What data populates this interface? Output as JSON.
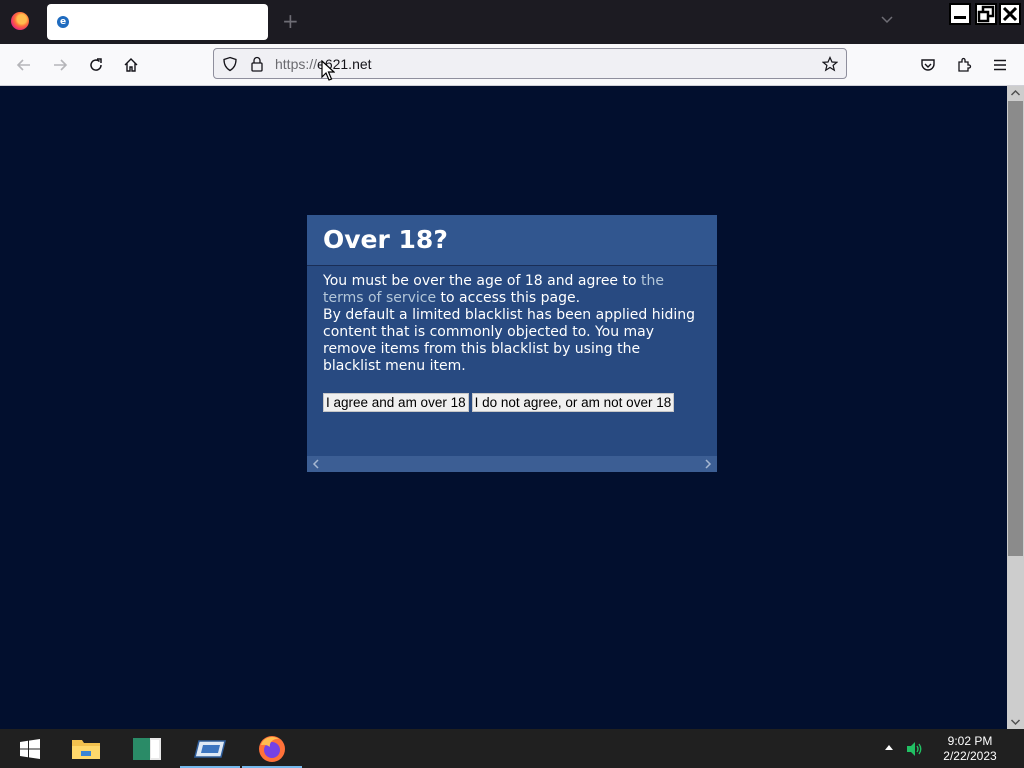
{
  "browser": {
    "tab": {
      "title": ""
    },
    "new_tab_label": "+",
    "url": {
      "scheme": "https://",
      "host": "e621.net"
    }
  },
  "dialog": {
    "title": "Over 18?",
    "text_before_link": "You must be over the age of 18 and agree to ",
    "link_text": "the terms of service",
    "text_after_link": " to access this page.",
    "paragraph2": "By default a limited blacklist has been applied hiding content that is commonly objected to. You may remove items from this blacklist by using the blacklist menu item.",
    "agree_button": "I agree and am over 18",
    "disagree_button": "I do not agree, or am not over 18"
  },
  "taskbar": {
    "time": "9:02 PM",
    "date": "2/22/2023"
  },
  "colors": {
    "page_background": "#020f2e",
    "dialog_background": "#284a81",
    "dialog_header": "#31568f",
    "link": "#b4c7d9"
  }
}
